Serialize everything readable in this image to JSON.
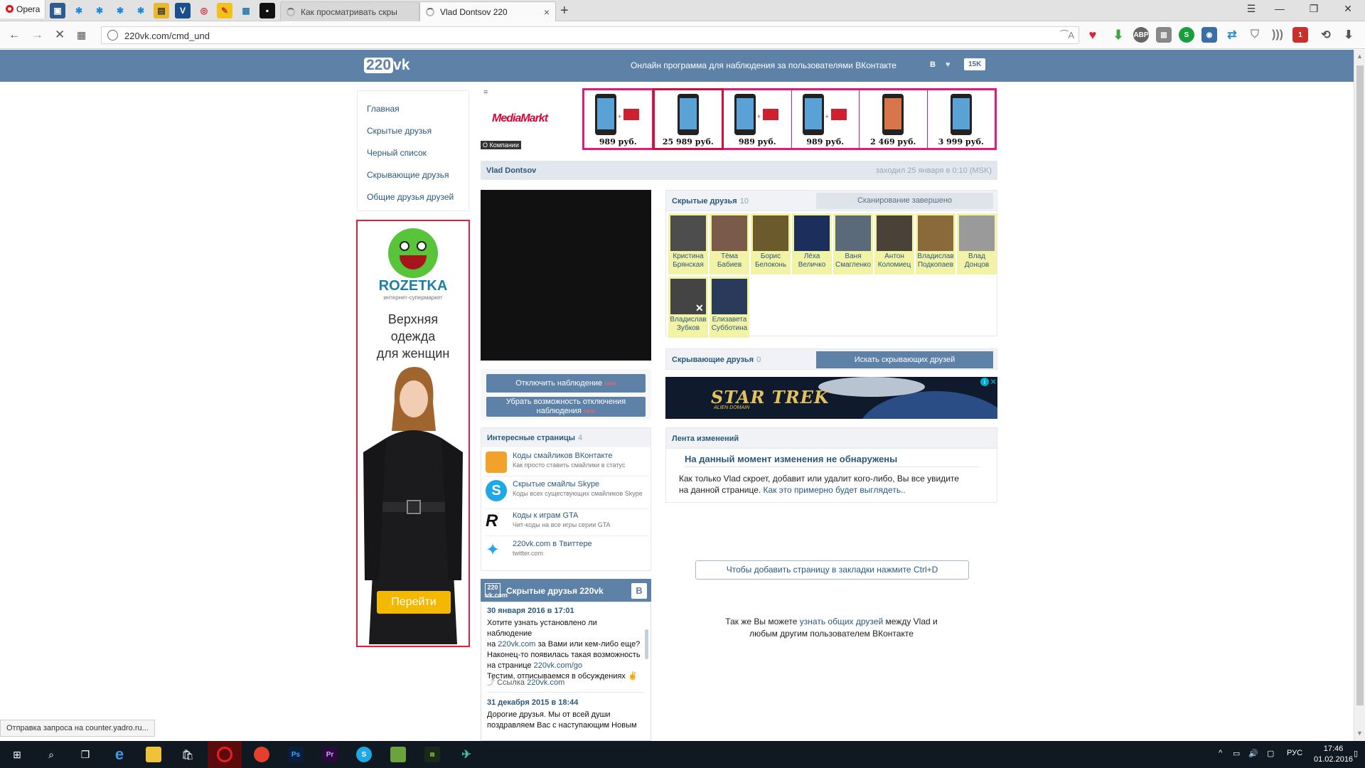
{
  "browser": {
    "menu_label": "Opera",
    "tabs": [
      {
        "title": "Как просматривать скры"
      },
      {
        "title": "Vlad Dontsov 220"
      }
    ],
    "url": "220vk.com/cmd_und",
    "translate_glyph": "⁀A",
    "status_text": "Отправка запроса на counter.yadro.ru..."
  },
  "header": {
    "logo_num": "220",
    "logo_text": "vk",
    "title": "Онлайн программа для наблюдения за пользователями ВКонтакте",
    "vk_label": "В",
    "counter": "15K"
  },
  "menu": {
    "items": [
      {
        "label": "Главная"
      },
      {
        "label": "Скрытые друзья"
      },
      {
        "label": "Черный список"
      },
      {
        "label": "Скрывающие друзья"
      },
      {
        "label": "Общие друзья друзей"
      }
    ]
  },
  "rozetka_ad": {
    "brand": "ROZETKA",
    "subtitle": "интернет-супермаркет",
    "title_line1": "Верхняя",
    "title_line2": "одежда",
    "title_line3": "для женщин",
    "button": "Перейти"
  },
  "mediamarkt_ad": {
    "brand": "MediaMarkt",
    "about": "О Компании",
    "menu_glyph": "=",
    "products": [
      {
        "price": "989 руб."
      },
      {
        "price": "25 989 руб."
      },
      {
        "price": "989 руб."
      },
      {
        "price": "989 руб."
      },
      {
        "price": "2 469 руб."
      },
      {
        "price": "3 999 руб."
      }
    ]
  },
  "profile": {
    "name": "Vlad Dontsov",
    "last_seen": "заходил 25 января в 0:10 (MSK)"
  },
  "actions": {
    "disable_monitoring": "Отключить наблюдение",
    "remove_disable_line1": "Убрать возможность отключения",
    "remove_disable_line2": "наблюдения",
    "new_tag": "new"
  },
  "interesting": {
    "title": "Интересные страницы",
    "count": "4",
    "items": [
      {
        "title": "Коды смайликов ВКонтакте",
        "desc": "Как просто ставить смайлики в статус"
      },
      {
        "title": "Скрытые смайлы Skype",
        "desc": "Коды всех существующих смайликов Skype"
      },
      {
        "title": "Коды к играм GTA",
        "desc": "Чит-коды на все игры серии GTA"
      },
      {
        "title": "220vk.com в Твиттере",
        "desc": "twitter.com"
      }
    ]
  },
  "widget": {
    "logo": "220 vk.com",
    "title": "Скрытые друзья 220vk",
    "vk": "В",
    "posts": [
      {
        "date": "30 января 2016 в 17:01",
        "line1": "Хотите узнать установлено ли наблюдение",
        "line2_pre": "на ",
        "line2_link": "220vk.com",
        "line2_post": " за Вами или кем-либо еще?",
        "line3": "Наконец-то появилась такая возможность",
        "line4_pre": "на странице ",
        "line4_link": "220vk.com/go",
        "line5": "Тестим, отписываемся в обсуждениях ✌",
        "link_label": "Ссылка",
        "link_url": "220vk.com"
      },
      {
        "date": "31 декабря 2015 в 18:44",
        "line1": "Дорогие друзья. Мы от всей души",
        "line2": "поздравляем Вас с наступающим Новым"
      }
    ]
  },
  "hidden_friends": {
    "title": "Скрытые друзья",
    "count": "10",
    "status": "Сканирование завершено",
    "friends": [
      {
        "first": "Кристина",
        "last": "Брянская"
      },
      {
        "first": "Тёма",
        "last": "Бабиев"
      },
      {
        "first": "Борис",
        "last": "Белоконь"
      },
      {
        "first": "Лёха",
        "last": "Величко"
      },
      {
        "first": "Ваня",
        "last": "Смагленко"
      },
      {
        "first": "Антон",
        "last": "Коломиец"
      },
      {
        "first": "Владислав",
        "last": "Подкопаев"
      },
      {
        "first": "Влад",
        "last": "Донцов"
      },
      {
        "first": "Владислав",
        "last": "Зубков"
      },
      {
        "first": "Елизавета",
        "last": "Субботина"
      }
    ]
  },
  "hiding_friends": {
    "title": "Скрывающие друзья",
    "count": "0",
    "button": "Искать скрывающих друзей"
  },
  "startrek_ad": {
    "title": "STAR TREK",
    "subtitle": "ALIEN DOMAIN"
  },
  "changes": {
    "title": "Лента изменений",
    "none_found": "На данный момент изменения не обнаружены",
    "text_line1": "Как только Vlad скроет, добавит или удалит кого-либо, Вы все увидите",
    "text_line2_pre": "на данной странице. ",
    "text_line2_link": "Как это примерно будет выглядеть.."
  },
  "bookmark_tip": "Чтобы добавить страницу в закладки нажмите Ctrl+D",
  "also": {
    "pre": "Так же Вы можете ",
    "link": "узнать общих друзей",
    "post": " между Vlad и",
    "line2": "любым другим пользователем ВКонтакте"
  },
  "taskbar": {
    "lang": "РУС",
    "time": "17:46",
    "date": "01.02.2016"
  },
  "colors": {
    "vk_blue": "#5e81a8",
    "link": "#2b587a",
    "mediamarkt_border": "#e5187c",
    "rozetka_border": "#e0203a"
  }
}
